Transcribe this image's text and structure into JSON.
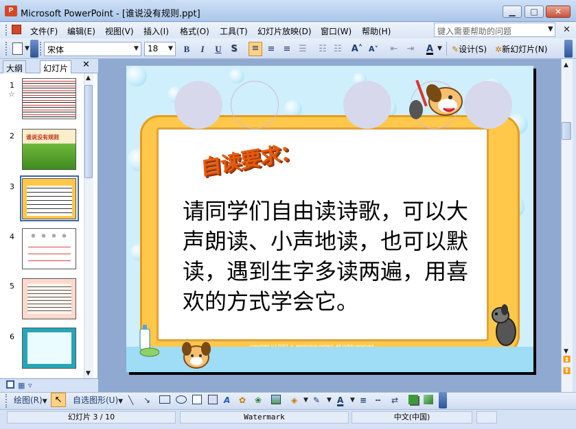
{
  "window": {
    "app_icon": "P",
    "title": "Microsoft PowerPoint - [谁说没有规则.ppt]",
    "buttons": {
      "minimize": "▁",
      "maximize": "□",
      "close": "✕"
    }
  },
  "menubar": {
    "items": [
      "文件(F)",
      "编辑(E)",
      "视图(V)",
      "插入(I)",
      "格式(O)",
      "工具(T)",
      "幻灯片放映(D)",
      "窗口(W)",
      "帮助(H)"
    ],
    "help_placeholder": "键入需要帮助的问题",
    "doc_close": "✕"
  },
  "toolbar": {
    "font": "宋体",
    "size": "18",
    "bold": "B",
    "italic": "I",
    "underline": "U",
    "shadow": "S",
    "design_label": "设计(S)",
    "new_slide_label": "新幻灯片(N)",
    "font_color_label": "A"
  },
  "left_pane": {
    "tabs": [
      "大纲",
      "幻灯片"
    ],
    "close": "✕",
    "slide_numbers": [
      "1",
      "2",
      "3",
      "4",
      "5",
      "6"
    ],
    "slide1_star": "☆",
    "thumb2_title": "谁说没有规则"
  },
  "slide": {
    "title": "自读要求：",
    "body": "请同学们自由读诗歌，可以大声朗读、小声地读，也可以默读，遇到生字多读两遍，用喜欢的方式学会它。",
    "copyright": "copyright (c) 2003, 4, woojoosun project. All rights reserved."
  },
  "drawbar": {
    "draw_label": "绘图(R)",
    "autoshapes_label": "自选图形(U)",
    "font_color_label": "A"
  },
  "status": {
    "slide_info": "幻灯片 3 / 10",
    "template": "Watermark",
    "language": "中文(中国)"
  },
  "colors": {
    "slide_bg": "#cfeffd",
    "frame": "#ffc84a",
    "title_orange": "#e65c0f"
  }
}
